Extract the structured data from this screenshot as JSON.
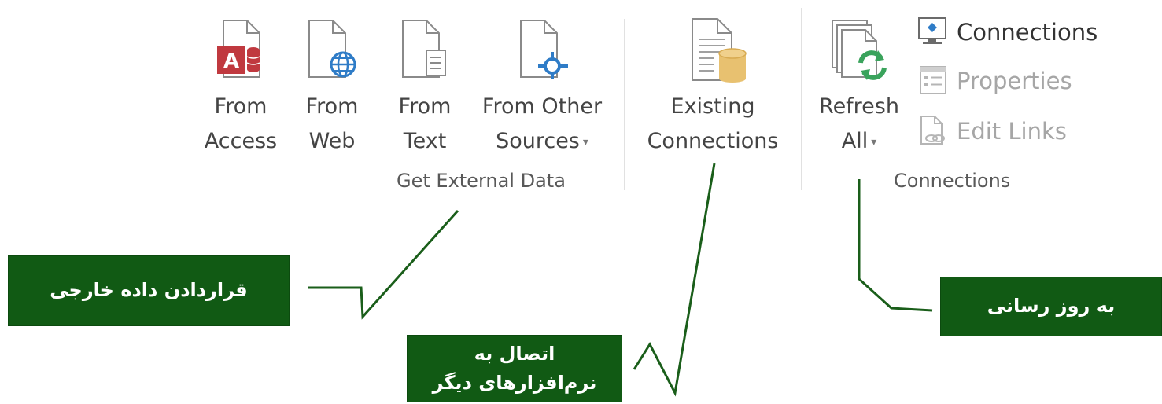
{
  "get_external_data": {
    "group_label": "Get External Data",
    "from_access": {
      "line1": "From",
      "line2": "Access"
    },
    "from_web": {
      "line1": "From",
      "line2": "Web"
    },
    "from_text": {
      "line1": "From",
      "line2": "Text"
    },
    "from_other": {
      "line1": "From Other",
      "line2": "Sources"
    }
  },
  "existing_connections": {
    "line1": "Existing",
    "line2": "Connections"
  },
  "connections_group": {
    "group_label": "Connections",
    "refresh_all": {
      "line1": "Refresh",
      "line2": "All"
    },
    "connections_label": "Connections",
    "properties_label": "Properties",
    "edit_links_label": "Edit Links"
  },
  "callouts": {
    "external_data": "قراردادن داده خارجی",
    "other_software_line1": "اتصال به",
    "other_software_line2": "نرم‌افزارهای دیگر",
    "refresh": "به روز رسانی"
  },
  "colors": {
    "callout_bg": "#115a14",
    "callout_line": "#1a5e1a",
    "access_red": "#c0393f",
    "web_blue": "#2f7cc7",
    "refresh_green": "#3aa35c",
    "db_gold": "#e8c170"
  }
}
